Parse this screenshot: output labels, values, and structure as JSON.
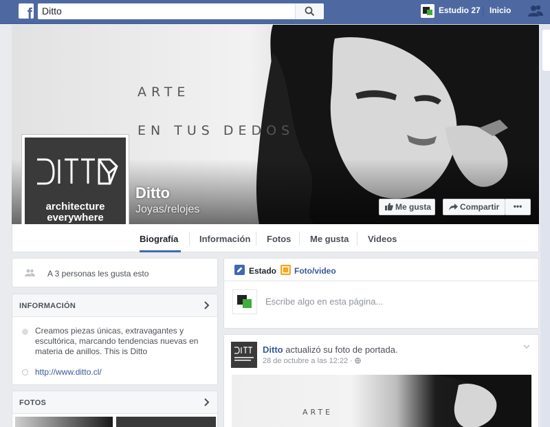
{
  "topbar": {
    "logo": "f",
    "search_value": "Ditto",
    "user_name": "Estudio 27",
    "home_label": "Inicio",
    "icons": [
      "facebook-logo-icon",
      "search-icon",
      "friends-icon"
    ]
  },
  "cover": {
    "line1": "ARTE",
    "line2": "EN TUS DEDOS"
  },
  "page": {
    "name": "Ditto",
    "category": "Joyas/relojes",
    "profile_line1": "architecture",
    "profile_line2": "everywhere"
  },
  "actions": {
    "like": "Me gusta",
    "share": "Compartir",
    "more": "•••"
  },
  "tabs": [
    {
      "label": "Biografía",
      "selected": true
    },
    {
      "label": "Información"
    },
    {
      "label": "Fotos"
    },
    {
      "label": "Me gusta"
    },
    {
      "label": "Videos"
    }
  ],
  "sidebar": {
    "likes_text": "A 3 personas les gusta esto",
    "info_title": "INFORMACIÓN",
    "info_description": "Creamos piezas únicas, extravagantes y escultórica, marcando tendencias nuevas en materia de anillos. This is Ditto",
    "info_url": "http://www.ditto.cl/",
    "photos_title": "FOTOS"
  },
  "composer": {
    "tab_status": "Estado",
    "tab_photo": "Foto/video",
    "placeholder": "Escribe algo en esta página..."
  },
  "post": {
    "author": "Ditto",
    "action": "actualizó su foto de portada.",
    "time": "28 de octubre a las 12:22 ·",
    "photo_text": "ARTE"
  },
  "colors": {
    "brand": "#4e69a2",
    "link": "#365899",
    "page_bg": "#e9ebee"
  }
}
